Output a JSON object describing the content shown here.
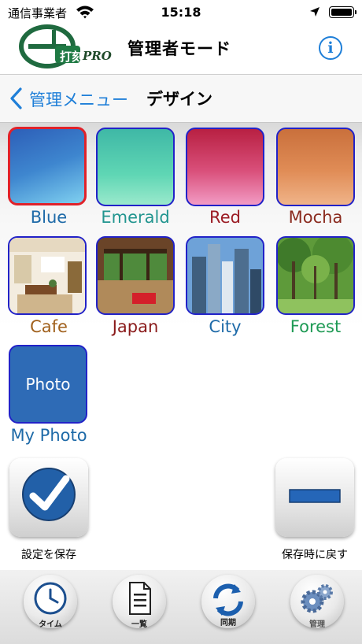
{
  "status_bar": {
    "carrier": "通信事業者",
    "time": "15:18"
  },
  "header": {
    "logo_text": "打刻",
    "logo_brand": "PRO",
    "title": "管理者モード",
    "info_symbol": "i"
  },
  "nav": {
    "back_label": "管理メニュー",
    "title": "デザイン"
  },
  "designs": [
    {
      "label": "Blue",
      "label_color": "#1e6aa8",
      "selected": true
    },
    {
      "label": "Emerald",
      "label_color": "#22958f",
      "selected": false
    },
    {
      "label": "Red",
      "label_color": "#9b1c24",
      "selected": false
    },
    {
      "label": "Mocha",
      "label_color": "#8a2a1e",
      "selected": false
    },
    {
      "label": "Cafe",
      "label_color": "#a0601c",
      "selected": false
    },
    {
      "label": "Japan",
      "label_color": "#8a1a1a",
      "selected": false
    },
    {
      "label": "City",
      "label_color": "#1e6aa8",
      "selected": false
    },
    {
      "label": "Forest",
      "label_color": "#1e9a54",
      "selected": false
    },
    {
      "label": "My Photo",
      "label_color": "#1e6aa8",
      "selected": false,
      "tile_text": "Photo"
    }
  ],
  "actions": {
    "save_label": "設定を保存",
    "revert_label": "保存時に戻す"
  },
  "tabs": [
    {
      "label": "タイム",
      "icon": "clock-icon"
    },
    {
      "label": "一覧",
      "icon": "document-icon"
    },
    {
      "label": "同期",
      "icon": "sync-icon"
    },
    {
      "label": "管理",
      "icon": "gears-icon"
    }
  ]
}
